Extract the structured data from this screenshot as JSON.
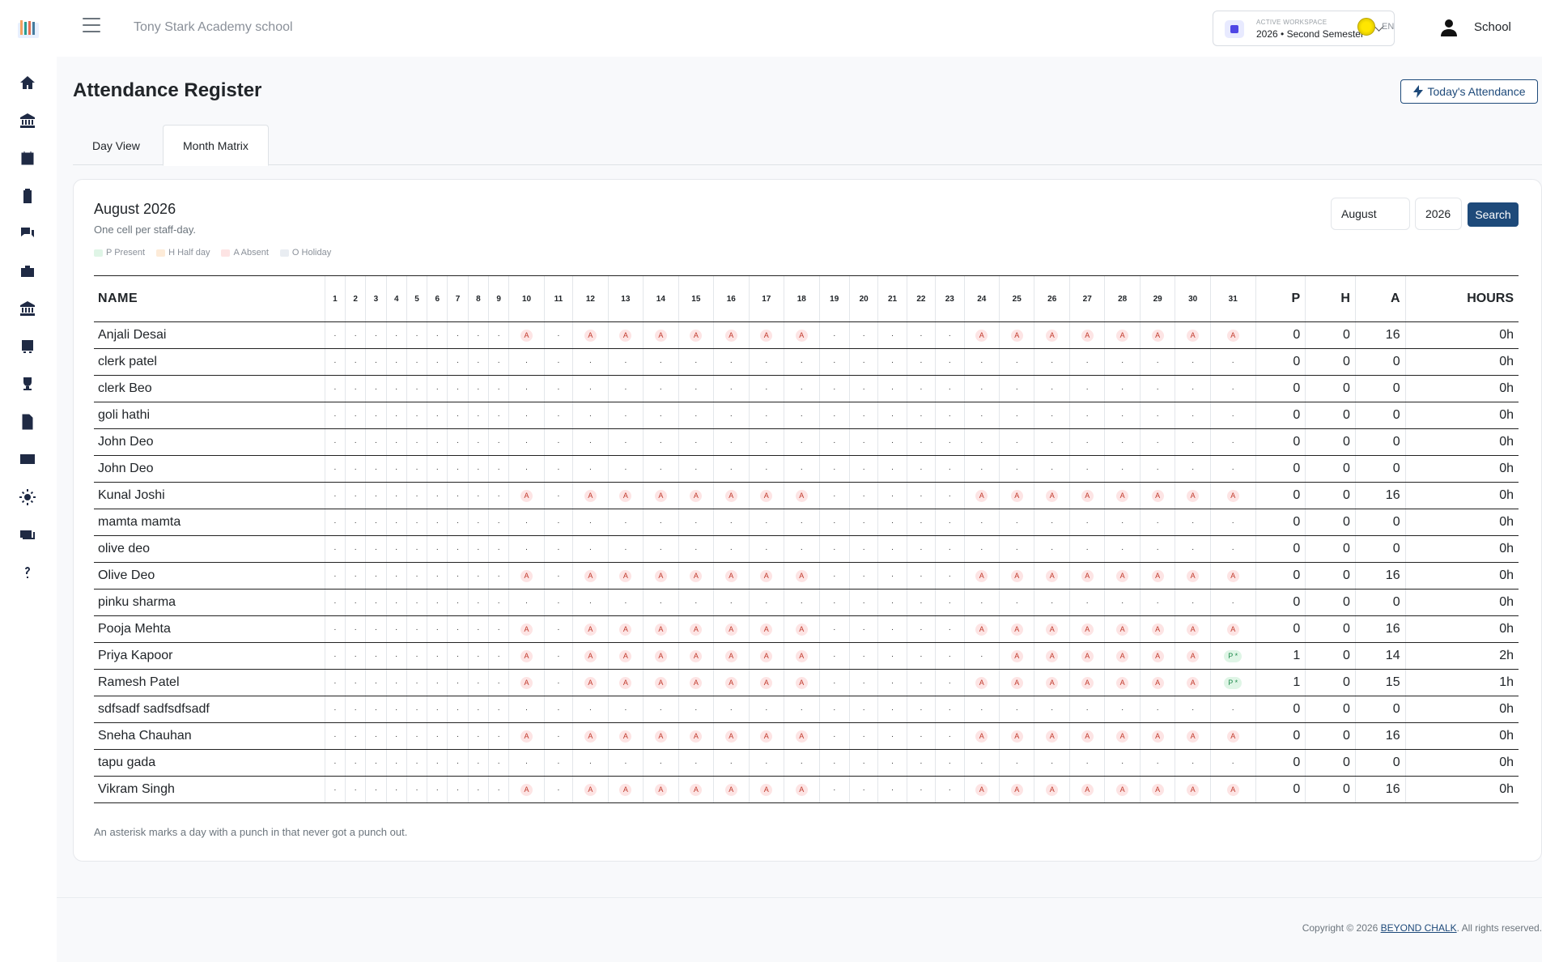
{
  "sidebar": {
    "icons": [
      "home-icon",
      "bank-icon",
      "calendar-icon",
      "clipboard-icon",
      "chat-icon",
      "briefcase-icon",
      "institution-icon",
      "bus-icon",
      "trophy-icon",
      "document-icon",
      "card-icon",
      "gear-icon",
      "money-icon",
      "help-icon"
    ]
  },
  "header": {
    "school_name": "Tony Stark Academy school",
    "workspace_label": "ACTIVE WORKSPACE",
    "workspace_value": "2026 • Second Semester",
    "language": "EN",
    "user_name": "School"
  },
  "page": {
    "title": "Attendance Register",
    "today_button": "Today's Attendance",
    "tabs": [
      "Day View",
      "Month Matrix"
    ],
    "active_tab": "Month Matrix"
  },
  "card": {
    "title": "August 2026",
    "subtitle": "One cell per staff-day.",
    "month_select": "August",
    "year_select": "2026",
    "search_button": "Search",
    "legend": [
      {
        "label": "P Present",
        "color": "#dff5e6"
      },
      {
        "label": "H Half day",
        "color": "#fdebd8"
      },
      {
        "label": "A Absent",
        "color": "#fde4e4"
      },
      {
        "label": "O Holiday",
        "color": "#e9edf2"
      }
    ],
    "note": "An asterisk marks a day with a punch in that never got a punch out."
  },
  "matrix": {
    "name_header": "NAME",
    "days": [
      "1",
      "2",
      "3",
      "4",
      "5",
      "6",
      "7",
      "8",
      "9",
      "10",
      "11",
      "12",
      "13",
      "14",
      "15",
      "16",
      "17",
      "18",
      "19",
      "20",
      "21",
      "22",
      "23",
      "24",
      "25",
      "26",
      "27",
      "28",
      "29",
      "30",
      "31"
    ],
    "total_headers": [
      "P",
      "H",
      "A",
      "HOURS"
    ],
    "rows": [
      {
        "name": "Anjali Desai",
        "cells": "·········A·AAAAAAA·····AAAAAAAA",
        "P": "0",
        "H": "0",
        "A": "16",
        "hours": "0h"
      },
      {
        "name": "clerk patel",
        "cells": "·······························",
        "P": "0",
        "H": "0",
        "A": "0",
        "hours": "0h"
      },
      {
        "name": "clerk Beo",
        "cells": "·······························",
        "P": "0",
        "H": "0",
        "A": "0",
        "hours": "0h"
      },
      {
        "name": "goli hathi",
        "cells": "·······························",
        "P": "0",
        "H": "0",
        "A": "0",
        "hours": "0h"
      },
      {
        "name": "John Deo",
        "cells": "·······························",
        "P": "0",
        "H": "0",
        "A": "0",
        "hours": "0h"
      },
      {
        "name": "John Deo",
        "cells": "·······························",
        "P": "0",
        "H": "0",
        "A": "0",
        "hours": "0h"
      },
      {
        "name": "Kunal Joshi",
        "cells": "·········A·AAAAAAA·····AAAAAAAA",
        "P": "0",
        "H": "0",
        "A": "16",
        "hours": "0h"
      },
      {
        "name": "mamta mamta",
        "cells": "·······························",
        "P": "0",
        "H": "0",
        "A": "0",
        "hours": "0h"
      },
      {
        "name": "olive deo",
        "cells": "·······························",
        "P": "0",
        "H": "0",
        "A": "0",
        "hours": "0h"
      },
      {
        "name": "Olive Deo",
        "cells": "·········A·AAAAAAA·····AAAAAAAA",
        "P": "0",
        "H": "0",
        "A": "16",
        "hours": "0h"
      },
      {
        "name": "pinku sharma",
        "cells": "·······························",
        "P": "0",
        "H": "0",
        "A": "0",
        "hours": "0h"
      },
      {
        "name": "Pooja Mehta",
        "cells": "·········A·AAAAAAA·····AAAAAAAA",
        "P": "0",
        "H": "0",
        "A": "16",
        "hours": "0h"
      },
      {
        "name": "Priya Kapoor",
        "cells": "·········A·AAAAAAA······AAAAAAP",
        "P": "1",
        "H": "0",
        "A": "14",
        "hours": "2h"
      },
      {
        "name": "Ramesh Patel",
        "cells": "·········A·AAAAAAA·····AAAAAAAP",
        "P": "1",
        "H": "0",
        "A": "15",
        "hours": "1h"
      },
      {
        "name": "sdfsadf sadfsdfsadf",
        "cells": "·······························",
        "P": "0",
        "H": "0",
        "A": "0",
        "hours": "0h"
      },
      {
        "name": "Sneha Chauhan",
        "cells": "·········A·AAAAAAA·····AAAAAAAA",
        "P": "0",
        "H": "0",
        "A": "16",
        "hours": "0h"
      },
      {
        "name": "tapu gada",
        "cells": "·······························",
        "P": "0",
        "H": "0",
        "A": "0",
        "hours": "0h"
      },
      {
        "name": "Vikram Singh",
        "cells": "·········A·AAAAAAA·····AAAAAAAA",
        "P": "0",
        "H": "0",
        "A": "16",
        "hours": "0h"
      }
    ]
  },
  "footer": {
    "prefix": "Copyright © 2026 ",
    "link": "BEYOND CHALK",
    "suffix": ". All rights reserved."
  }
}
